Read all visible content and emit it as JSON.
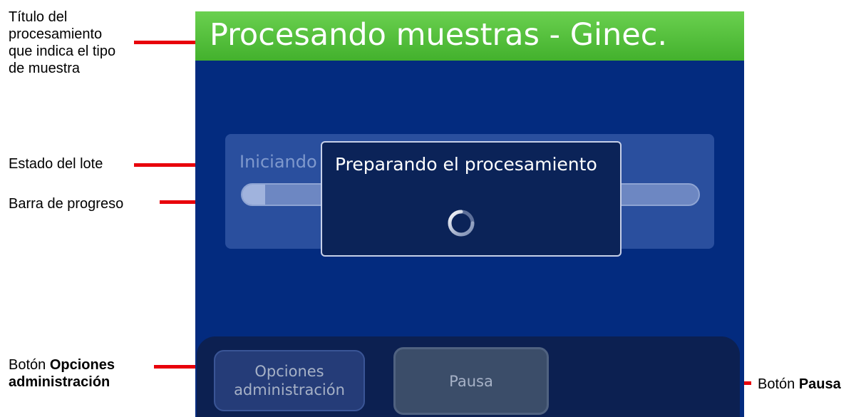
{
  "screen": {
    "title": "Procesando muestras - Ginec.",
    "batch_status": "Iniciando",
    "progress_fraction": 0.05,
    "dialog": {
      "message": "Preparando el procesamiento"
    },
    "buttons": {
      "admin_line1": "Opciones",
      "admin_line2": "administración",
      "pause": "Pausa"
    }
  },
  "callouts": {
    "title_line1": "Título del",
    "title_line2": "procesamiento",
    "title_line3": "que indica el tipo",
    "title_line4": "de muestra",
    "batch_status": "Estado del lote",
    "progress_bar": "Barra de progreso",
    "admin_prefix": "Botón",
    "admin_bold_line1": "Opciones",
    "admin_bold_line2": "administración",
    "pause_prefix": "Botón",
    "pause_bold": "Pausa"
  },
  "colors": {
    "title_bar": "#4cbb33",
    "screen_background": "#032b7f",
    "leader_lines": "#e8000b"
  },
  "icons": {
    "spinner": "loading-spinner-icon"
  }
}
